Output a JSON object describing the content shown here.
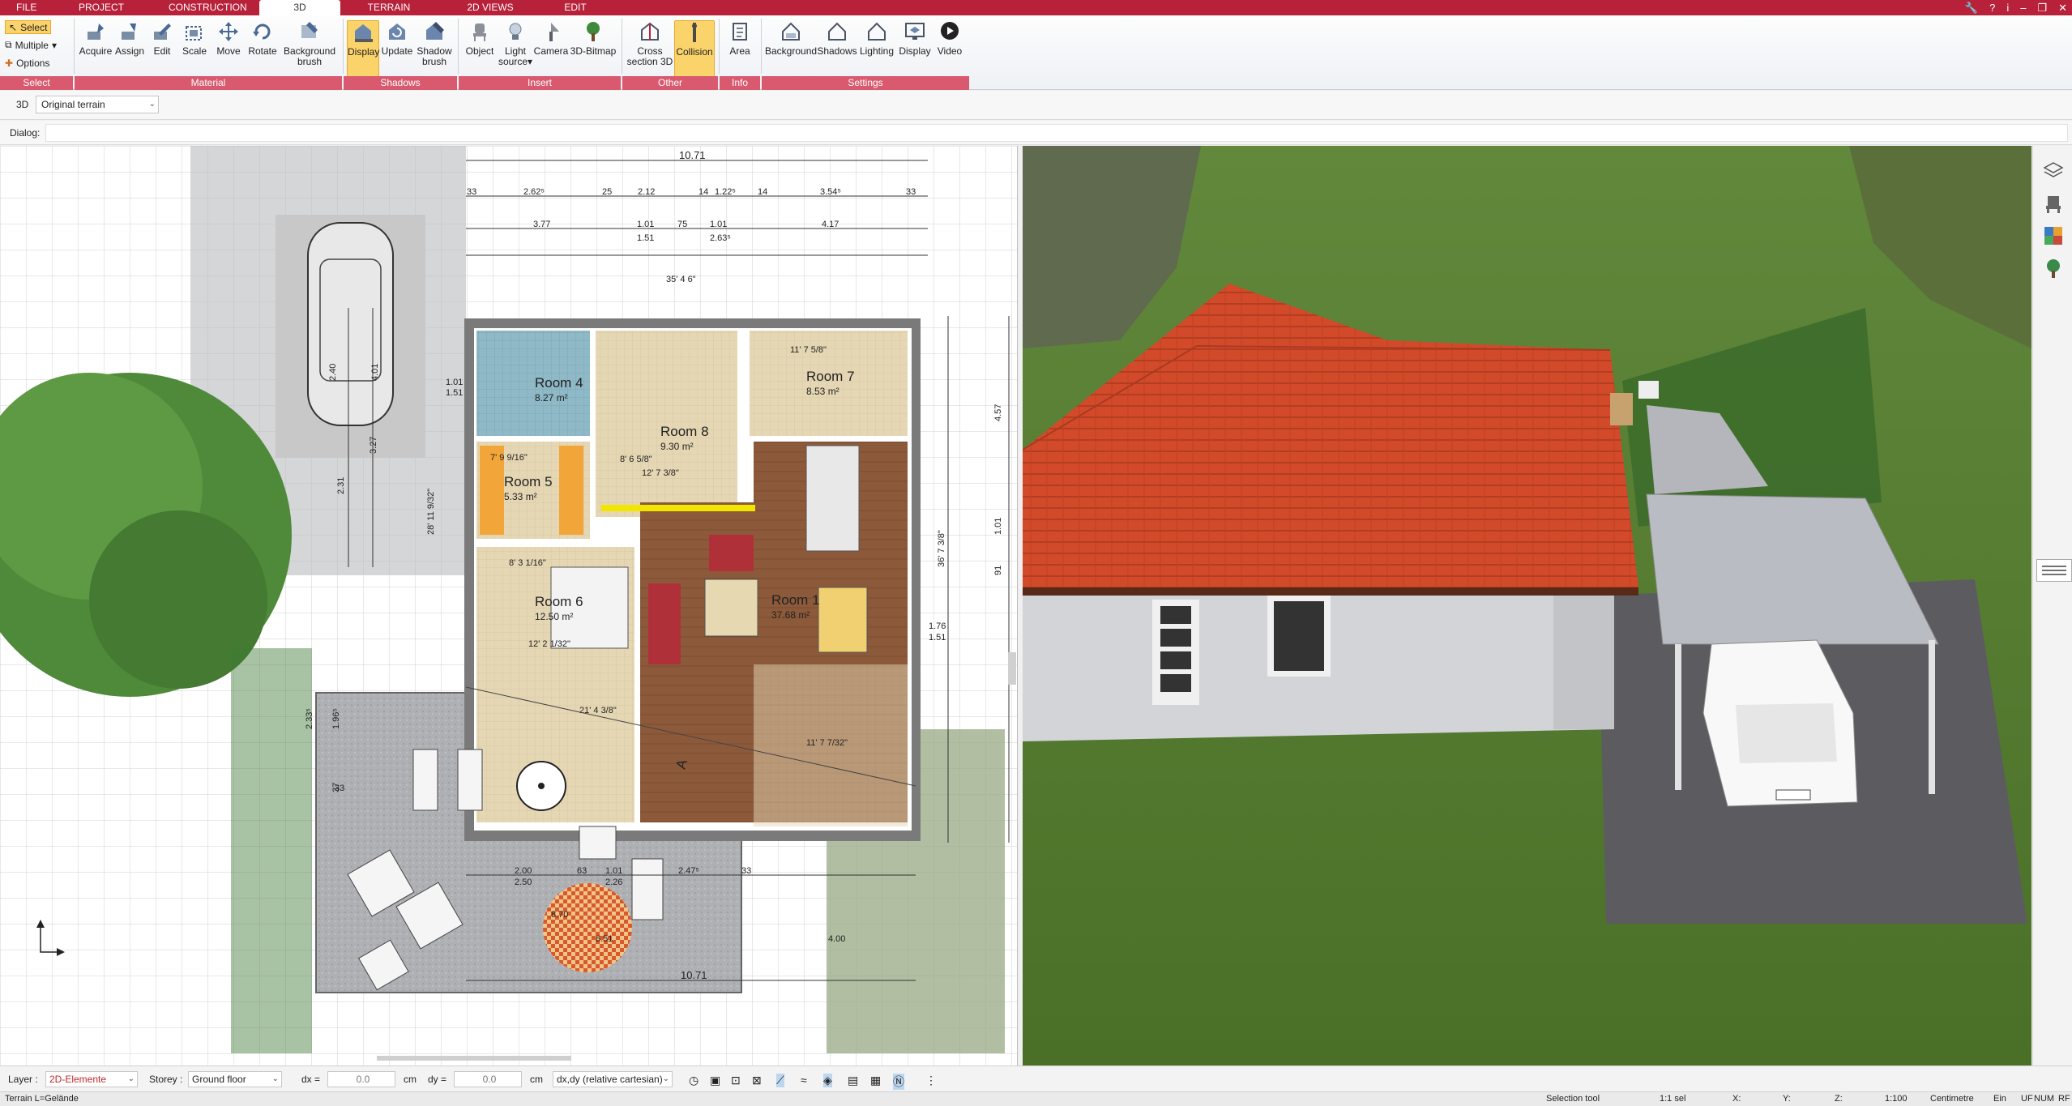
{
  "tabs": [
    {
      "label": "FILE"
    },
    {
      "label": "PROJECT"
    },
    {
      "label": "CONSTRUCTION"
    },
    {
      "label": "3D",
      "active": true
    },
    {
      "label": "TERRAIN"
    },
    {
      "label": "2D VIEWS"
    },
    {
      "label": "EDIT"
    }
  ],
  "ribbon": {
    "select_group": {
      "select": "Select",
      "multiple": "Multiple",
      "options": "Options",
      "label": "Select"
    },
    "material_group": {
      "label": "Material",
      "buttons": [
        {
          "label": "Acquire",
          "icon": "acquire-icon"
        },
        {
          "label": "Assign",
          "icon": "assign-icon"
        },
        {
          "label": "Edit",
          "icon": "edit-icon"
        },
        {
          "label": "Scale",
          "icon": "scale-icon"
        },
        {
          "label": "Move",
          "icon": "move-icon"
        },
        {
          "label": "Rotate",
          "icon": "rotate-icon"
        },
        {
          "label": "Background",
          "label2": "brush",
          "icon": "background-brush-icon"
        }
      ]
    },
    "shadows_group": {
      "label": "Shadows",
      "buttons": [
        {
          "label": "Display",
          "icon": "display-icon",
          "active": true
        },
        {
          "label": "Update",
          "icon": "update-icon"
        },
        {
          "label": "Shadow",
          "label2": "brush",
          "icon": "shadow-brush-icon"
        }
      ]
    },
    "insert_group": {
      "label": "Insert",
      "buttons": [
        {
          "label": "Object",
          "icon": "object-icon"
        },
        {
          "label": "Light",
          "label2": "source",
          "icon": "light-source-icon"
        },
        {
          "label": "Camera",
          "icon": "camera-icon"
        },
        {
          "label": "3D-Bitmap",
          "icon": "bitmap-tree-icon"
        }
      ]
    },
    "other_group": {
      "label": "Other",
      "buttons": [
        {
          "label": "Cross",
          "label2": "section 3D",
          "icon": "cross-section-icon"
        },
        {
          "label": "Collision",
          "icon": "collision-icon",
          "active": true
        }
      ]
    },
    "info_group": {
      "label": "Info",
      "buttons": [
        {
          "label": "Area",
          "icon": "area-icon"
        }
      ]
    },
    "settings_group": {
      "label": "Settings",
      "buttons": [
        {
          "label": "Background",
          "icon": "background-house-icon"
        },
        {
          "label": "Shadows",
          "icon": "shadows-house-icon"
        },
        {
          "label": "Lighting",
          "icon": "lighting-house-icon"
        },
        {
          "label": "Display",
          "icon": "display-monitor-icon"
        },
        {
          "label": "Video",
          "icon": "video-play-icon"
        }
      ]
    }
  },
  "subbar": {
    "mode": "3D",
    "terrain": "Original terrain"
  },
  "dialog": {
    "label": "Dialog:"
  },
  "plan": {
    "rooms": [
      {
        "name": "Room 4",
        "area": "8.27 m²"
      },
      {
        "name": "Room 5",
        "area": "5.33 m²"
      },
      {
        "name": "Room 6",
        "area": "12.50 m²"
      },
      {
        "name": "Room 7",
        "area": "8.53 m²"
      },
      {
        "name": "Room 8",
        "area": "9.30 m²"
      },
      {
        "name": "Room 1",
        "area": "37.68 m²"
      }
    ],
    "dims": {
      "top_total": "10.71",
      "top_row1": [
        "33",
        "2.62⁵",
        "25",
        "2.12",
        "14",
        "1.22⁵",
        "14",
        "3.54⁵",
        "33"
      ],
      "top_row2": [
        "3.77",
        "1.01",
        "75",
        "1.01",
        "4.17"
      ],
      "top_row3": [
        "1.51",
        "2.63⁵"
      ],
      "bottom_total": "10.71",
      "bottom_row": [
        "2.00",
        "63",
        "1.01",
        "2.47⁵",
        "33"
      ],
      "bottom_row2": [
        "2.50",
        "2.26"
      ],
      "terrace": "21' 4 3/8\"",
      "left_vert": [
        "2.40",
        "4.01",
        "3.27",
        "2.31",
        "1.01",
        "1.51"
      ],
      "right_vert": [
        "4.57",
        "1.01",
        "91",
        "1.76",
        "1.51"
      ],
      "misc": [
        "28' 11 9/32\"",
        "36' 7 3/8\"",
        "11' 7 5/8\"",
        "11' 7 7/32\"",
        "12' 7 3/8\"",
        "8' 6 5/8\"",
        "8' 3 1/16\"",
        "12' 2 1/32\"",
        "7' 9 9/16\"",
        "35' 4 6\"",
        "1.96⁵",
        "2.33⁵",
        "37",
        "33",
        "8.70",
        "6.51",
        "4.00"
      ],
      "section_label": "A"
    }
  },
  "bottom": {
    "layer_label": "Layer :",
    "layer_value": "2D-Elemente",
    "storey_label": "Storey :",
    "storey_value": "Ground floor",
    "dx_label": "dx =",
    "dx_value": "0.0",
    "dx_unit": "cm",
    "dy_label": "dy =",
    "dy_value": "0.0",
    "dy_unit": "cm",
    "coord_mode": "dx,dy (relative cartesian)"
  },
  "status": {
    "left": "Terrain L=Gelände",
    "tool": "Selection tool",
    "sel": "1:1 sel",
    "x": "X:",
    "y": "Y:",
    "z": "Z:",
    "scale": "1:100",
    "unit": "Centimetre",
    "ein": "Ein",
    "uf": "UF",
    "num": "NUM",
    "rf": "RF"
  },
  "colors": {
    "accent": "#b8213a",
    "group_label": "#d9596f",
    "active_btn": "#fbd36b",
    "roof": "#d24a2a",
    "grass": "#4f7a2e"
  }
}
